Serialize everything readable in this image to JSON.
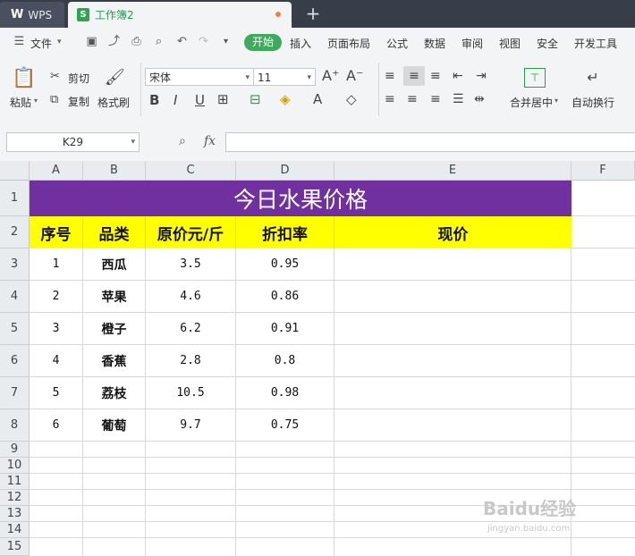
{
  "titlebar": {
    "wps_logo": "W",
    "wps_label": "WPS",
    "doc_icon": "S",
    "doc_tab": "工作簿2",
    "new_tab": "+"
  },
  "menu": {
    "file": "文件",
    "items": [
      "开始",
      "插入",
      "页面布局",
      "公式",
      "数据",
      "审阅",
      "视图",
      "安全",
      "开发工具"
    ]
  },
  "ribbon": {
    "paste": "粘贴",
    "cut": "剪切",
    "copy": "复制",
    "format_painter": "格式刷",
    "font_name": "宋体",
    "font_size": "11",
    "merge_center": "合并居中",
    "wrap_text": "自动换行"
  },
  "formula_bar": {
    "cell_ref": "K29",
    "fx": "fx",
    "content": ""
  },
  "sheet": {
    "columns": [
      "A",
      "B",
      "C",
      "D",
      "E",
      "F"
    ],
    "rows": [
      "1",
      "2",
      "3",
      "4",
      "5",
      "6",
      "7",
      "8",
      "9",
      "10",
      "11",
      "12",
      "13",
      "14",
      "15"
    ],
    "title": "今日水果价格",
    "headers": [
      "序号",
      "品类",
      "原价元/斤",
      "折扣率",
      "现价"
    ],
    "data": [
      [
        "1",
        "西瓜",
        "3.5",
        "0.95",
        ""
      ],
      [
        "2",
        "苹果",
        "4.6",
        "0.86",
        ""
      ],
      [
        "3",
        "橙子",
        "6.2",
        "0.91",
        ""
      ],
      [
        "4",
        "香蕉",
        "2.8",
        "0.8",
        ""
      ],
      [
        "5",
        "荔枝",
        "10.5",
        "0.98",
        ""
      ],
      [
        "6",
        "葡萄",
        "9.7",
        "0.75",
        ""
      ]
    ]
  },
  "watermark": {
    "text": "Baidu经验",
    "url": "jingyan.baidu.com"
  },
  "colors": {
    "title_fill": "#7030a0",
    "header_fill": "#ffff00",
    "accent": "#3eaa5b"
  }
}
